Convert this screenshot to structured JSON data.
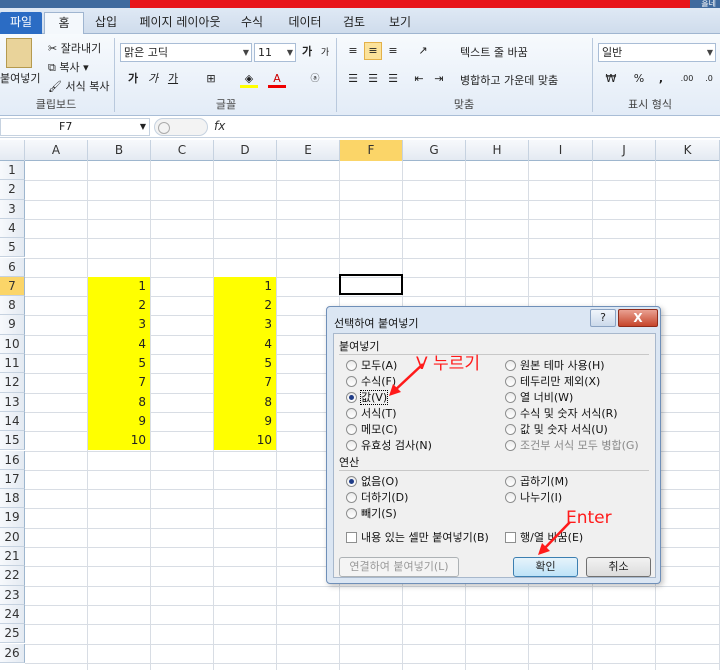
{
  "title_right": "홀네",
  "tabs": [
    "파일",
    "홈",
    "삽입",
    "페이지 레이아웃",
    "수식",
    "데이터",
    "검토",
    "보기"
  ],
  "clipboard": {
    "paste": "붙여넣기",
    "cut": "잘라내기",
    "copy": "복사",
    "format_painter": "서식 복사",
    "group": "클립보드"
  },
  "font": {
    "name": "맑은 고딕",
    "size": "11",
    "bold": "가",
    "italic": "가",
    "underline": "가",
    "group": "글꼴",
    "grow": "가",
    "shrink": "가"
  },
  "alignment": {
    "wrap": "텍스트 줄 바꿈",
    "merge": "병합하고 가운데 맞춤",
    "group": "맞춤"
  },
  "number": {
    "format": "일반",
    "group": "표시 형식",
    "percent": "%",
    "comma": ","
  },
  "formula_bar": {
    "name_box": "F7",
    "fx": "fx"
  },
  "columns": [
    "A",
    "B",
    "C",
    "D",
    "E",
    "F",
    "G",
    "H",
    "I",
    "J",
    "K"
  ],
  "rows": [
    "1",
    "2",
    "3",
    "4",
    "5",
    "6",
    "7",
    "8",
    "9",
    "10",
    "11",
    "12",
    "13",
    "14",
    "15",
    "16",
    "17",
    "18",
    "19",
    "20",
    "21",
    "22",
    "23",
    "24",
    "25",
    "26"
  ],
  "col_b_values": [
    "1",
    "2",
    "3",
    "4",
    "5",
    "7",
    "8",
    "9",
    "10"
  ],
  "col_d_values": [
    "1",
    "2",
    "3",
    "4",
    "5",
    "7",
    "8",
    "9",
    "10"
  ],
  "dialog": {
    "title": "선택하여 붙여넣기",
    "help": "?",
    "close": "X",
    "paste_section": "붙여넣기",
    "paste_left": [
      "모두(A)",
      "수식(F)",
      "값(V)",
      "서식(T)",
      "메모(C)",
      "유효성 검사(N)"
    ],
    "paste_right": [
      "원본 테마 사용(H)",
      "테두리만 제외(X)",
      "열 너비(W)",
      "수식 및 숫자 서식(R)",
      "값 및 숫자 서식(U)",
      "조건부 서식 모두 병합(G)"
    ],
    "op_section": "연산",
    "op_left": [
      "없음(O)",
      "더하기(D)",
      "빼기(S)"
    ],
    "op_right": [
      "곱하기(M)",
      "나누기(I)"
    ],
    "skip_blanks": "내용 있는 셀만 붙여넣기(B)",
    "transpose": "행/열 바꿈(E)",
    "paste_link": "연결하여 붙여넣기(L)",
    "ok": "확인",
    "cancel": "취소"
  },
  "annotations": {
    "press_v": "V 누르기",
    "enter": "Enter"
  },
  "colors": {
    "highlight": "#ffff00",
    "annotation": "#ff1a1a",
    "file_tab": "#2b6cc4"
  }
}
